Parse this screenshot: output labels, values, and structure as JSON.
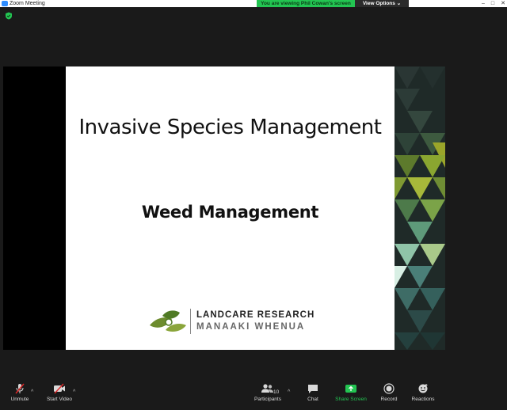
{
  "window": {
    "title": "Zoom Meeting"
  },
  "banner": {
    "text": "You are viewing Phil Cowan's screen",
    "options_label": "View Options ⌄"
  },
  "slide": {
    "title": "Invasive Species Management",
    "subtitle": "Weed Management",
    "logo": {
      "line1": "LANDCARE RESEARCH",
      "line2": "MANAAKI WHENUA"
    }
  },
  "toolbar": {
    "unmute": "Unmute",
    "start_video": "Start Video",
    "participants": "Participants",
    "participant_count": "10",
    "chat": "Chat",
    "share_screen": "Share Screen",
    "record": "Record",
    "reactions": "Reactions"
  },
  "colors": {
    "share_green": "#23c552",
    "banner_green": "#23c552",
    "mute_red": "#e02828"
  },
  "icons": [
    "zoom-app-icon",
    "encryption-shield-icon",
    "microphone-muted-icon",
    "video-off-icon",
    "participants-icon",
    "chat-icon",
    "share-screen-icon",
    "record-icon",
    "reactions-icon"
  ]
}
